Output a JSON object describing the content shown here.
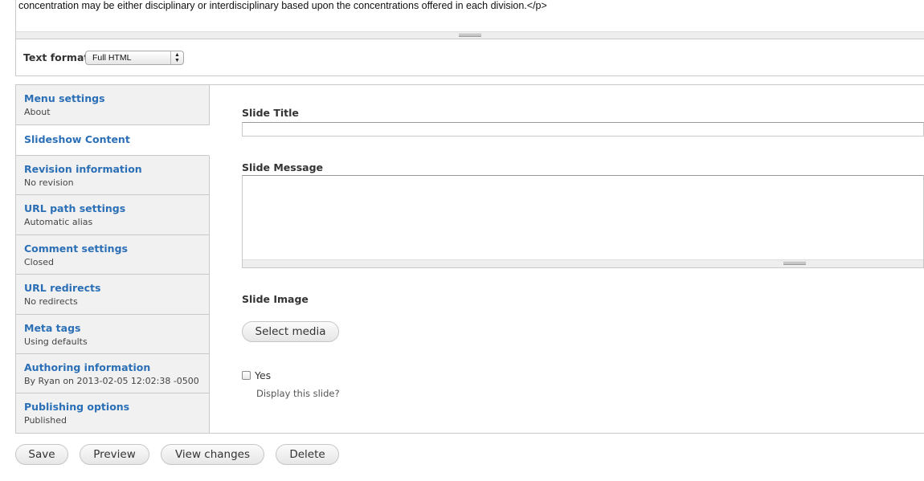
{
  "editor": {
    "body_text": "concentration may be either disciplinary or interdisciplinary based upon the concentrations offered in each division.</p>"
  },
  "text_format": {
    "label": "Text format",
    "selected": "Full HTML"
  },
  "vertical_tabs": [
    {
      "title": "Menu settings",
      "summary": "About"
    },
    {
      "title": "Slideshow Content",
      "summary": ""
    },
    {
      "title": "Revision information",
      "summary": "No revision"
    },
    {
      "title": "URL path settings",
      "summary": "Automatic alias"
    },
    {
      "title": "Comment settings",
      "summary": "Closed"
    },
    {
      "title": "URL redirects",
      "summary": "No redirects"
    },
    {
      "title": "Meta tags",
      "summary": "Using defaults"
    },
    {
      "title": "Authoring information",
      "summary": "By Ryan on 2013-02-05 12:02:38 -0500"
    },
    {
      "title": "Publishing options",
      "summary": "Published"
    }
  ],
  "slideshow": {
    "slide_title_label": "Slide Title",
    "slide_title_value": "",
    "slide_message_label": "Slide Message",
    "slide_message_value": "",
    "slide_image_label": "Slide Image",
    "select_media_label": "Select media",
    "display_checkbox_label": "Yes",
    "display_checkbox_checked": false,
    "display_description": "Display this slide?"
  },
  "actions": {
    "save": "Save",
    "preview": "Preview",
    "view_changes": "View changes",
    "delete": "Delete"
  },
  "colors": {
    "link_blue": "#2b6fb6",
    "tab_background": "#f1f1f1",
    "border": "#c9c9c9"
  }
}
